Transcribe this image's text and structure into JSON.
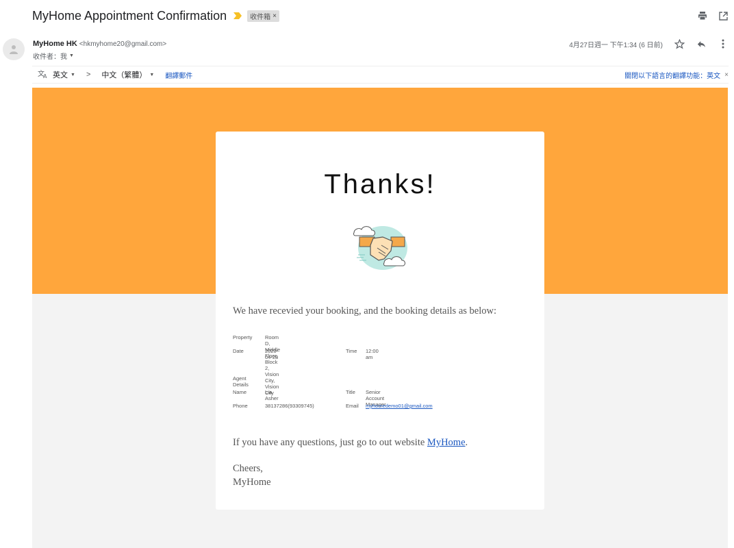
{
  "email": {
    "subject": "MyHome Appointment Confirmation",
    "label": "收件箱",
    "label_remove": "×"
  },
  "sender": {
    "name": "MyHome HK",
    "email": "<hkmyhome20@gmail.com>",
    "recipient": "收件者：我"
  },
  "date": "4月27日週一 下午1:34 (6 日前)",
  "translate": {
    "from_lang": "英文",
    "arrow": ">",
    "to_lang": "中文（繁體）",
    "translate_link": "翻譯郵件",
    "disable_text": "關閉以下語言的翻譯功能：英文",
    "close": "×"
  },
  "body": {
    "heading": "Thanks!",
    "intro": "We have recevied your booking, and the booking details as below:",
    "property_label": "Property",
    "property_value": "Room D, Middle Floor, Block 2, Vision City, Vision City",
    "date_label": "Date",
    "date_value": "2020-04-28",
    "time_label": "Time",
    "time_value": "12:00 am",
    "agent_heading": "Agent Details",
    "name_label": "Name",
    "name_value": "Lia Asher",
    "title_label": "Title",
    "title_value": "Senior Account Manager",
    "phone_label": "Phone",
    "phone_value": "38137286(93309745)",
    "email_label": "Email",
    "email_value": "myhomedemo01@gmail.com",
    "question_text": "If you have any questions, just go to out website ",
    "website_link": "MyHome",
    "question_end": ".",
    "cheers": "Cheers,",
    "signature": "MyHome"
  },
  "icons": [
    "printer-icon",
    "open-new-window-icon",
    "important-marker-icon",
    "avatar-person-icon",
    "star-icon",
    "reply-icon",
    "more-vert-icon",
    "translate-icon",
    "handshake-illustration"
  ],
  "colors": {
    "banner": "#ffa63c",
    "body_bg": "#f3f3f3",
    "link": "#1a57c0",
    "importance": "#f6c026"
  }
}
